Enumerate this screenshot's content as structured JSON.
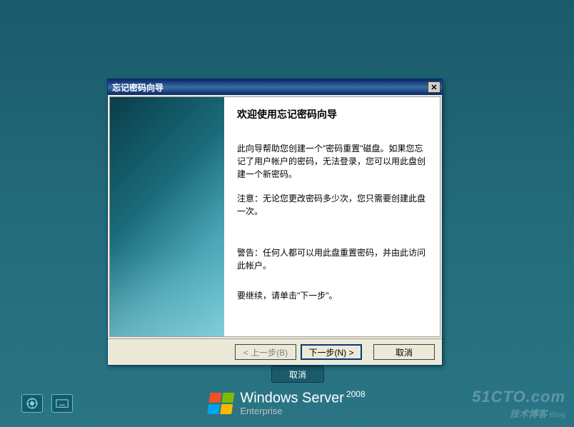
{
  "dialog": {
    "title": "忘记密码向导",
    "heading": "欢迎使用忘记密码向导",
    "para1": "此向导帮助您创建一个\"密码重置\"磁盘。如果您忘记了用户帐户的密码，无法登录，您可以用此盘创建一个新密码。",
    "para2": "注意：无论您更改密码多少次，您只需要创建此盘一次。",
    "para3": "警告：任何人都可以用此盘重置密码，并由此访问此帐户。",
    "para4": "要继续，请单击\"下一步\"。",
    "buttons": {
      "back": "< 上一步(B)",
      "next": "下一步(N) >",
      "cancel": "取消"
    }
  },
  "bg_cancel": "取消",
  "branding": {
    "line1_a": "Windows",
    "line1_b": "Server",
    "year": "2008",
    "line2": "Enterprise"
  },
  "watermark": {
    "top": "51CTO.com",
    "bottom": "技术博客",
    "blog": "Blog"
  }
}
